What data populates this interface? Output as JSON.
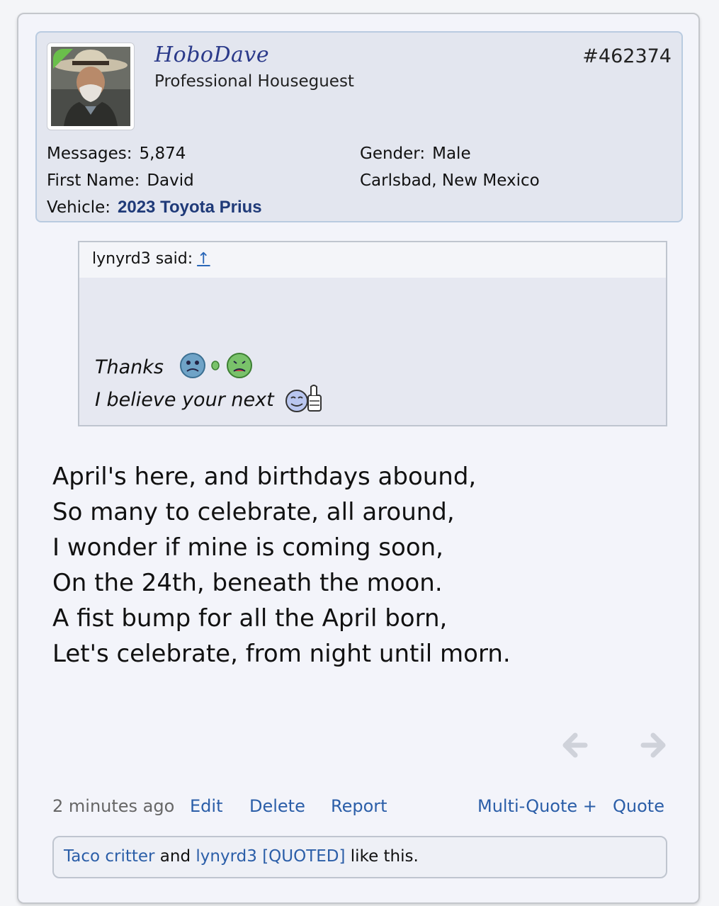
{
  "user": {
    "name": "HoboDave",
    "title": "Professional Houseguest",
    "post_number": "#462374",
    "messages_label": "Messages:",
    "messages": "5,874",
    "first_name_label": "First Name:",
    "first_name": "David",
    "vehicle_label": "Vehicle:",
    "vehicle": "2023 Toyota Prius",
    "gender_label": "Gender:",
    "gender": "Male",
    "location": "Carlsbad, New Mexico",
    "online_status_color": "#6abf4b"
  },
  "quote": {
    "author_said": "lynyrd3 said:",
    "jump_icon": "up-arrow-icon",
    "line1": "Thanks",
    "line2": "I believe your next",
    "smilies": [
      "sick-face-icon",
      "vomit-face-icon",
      "thumbs-up-face-icon"
    ]
  },
  "poem": [
    "April's here, and birthdays abound,",
    "So many to celebrate, all around,",
    "I wonder if mine is coming soon,",
    "On the 24th, beneath the moon.",
    "A fist bump for all the April born,",
    "Let's celebrate, from night until morn."
  ],
  "navigation": {
    "prev_icon": "arrow-left-icon",
    "next_icon": "arrow-right-icon"
  },
  "footer": {
    "time": "2 minutes ago",
    "edit": "Edit",
    "delete": "Delete",
    "report": "Report",
    "multi_quote": "Multi-Quote +",
    "quote": "Quote"
  },
  "likes": {
    "user1": "Taco critter",
    "and": " and ",
    "user2": "lynyrd3",
    "quoted": " [QUOTED]",
    "suffix": " like this."
  },
  "colors": {
    "link": "#2b5ea8",
    "username": "#2b3a8a",
    "vehicle": "#1f3a78"
  }
}
